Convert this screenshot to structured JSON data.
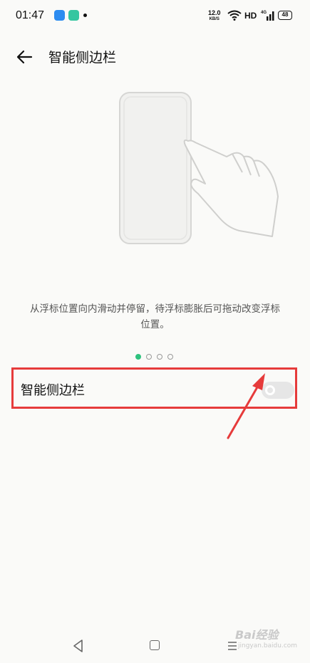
{
  "status_bar": {
    "time": "01:47",
    "net_speed_value": "12.0",
    "net_speed_unit": "KB/S",
    "hd_label": "HD",
    "cell_label": "4G",
    "battery_level": "48"
  },
  "header": {
    "title": "智能侧边栏",
    "back_icon": "back-arrow-icon"
  },
  "illustration": {
    "icons": [
      "phone-outline-icon",
      "hand-swipe-icon"
    ]
  },
  "description": "从浮标位置向内滑动并停留，待浮标膨胀后可拖动改变浮标位置。",
  "pager": {
    "count": 4,
    "active_index": 0,
    "active_color": "#2ec27e"
  },
  "setting": {
    "label": "智能侧边栏",
    "enabled": false,
    "highlight_color": "#e63b3b"
  },
  "nav_bar": {
    "icons": [
      "back-triangle-icon",
      "home-square-icon",
      "menu-lines-icon"
    ]
  },
  "watermark": {
    "brand": "Bai经验",
    "sub": "jingyan.baidu.com"
  }
}
